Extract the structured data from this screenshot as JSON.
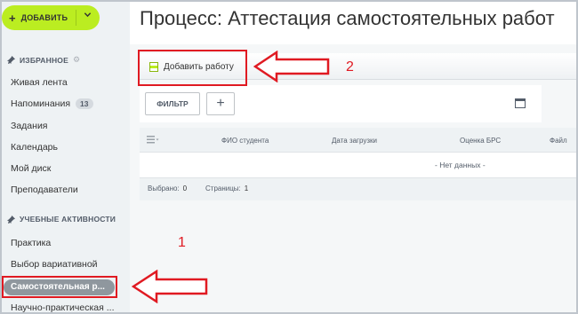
{
  "sidebar": {
    "add_button": {
      "label": "ДОБАВИТЬ",
      "plus": "+",
      "chevron": "⌄"
    },
    "favorites": {
      "title": "ИЗБРАННОЕ",
      "items": [
        {
          "label": "Живая лента"
        },
        {
          "label": "Напоминания",
          "counter": "13"
        },
        {
          "label": "Задания"
        },
        {
          "label": "Календарь"
        },
        {
          "label": "Мой диск"
        },
        {
          "label": "Преподаватели"
        }
      ]
    },
    "activities": {
      "title": "УЧЕБНЫЕ АКТИВНОСТИ",
      "items": [
        {
          "label": "Практика"
        },
        {
          "label": "Выбор вариативной"
        },
        {
          "label": "Самостоятельная р..."
        },
        {
          "label": "Научно-практическая ..."
        }
      ]
    }
  },
  "main": {
    "title": "Процесс: Аттестация самостоятельных работ",
    "toolbar": {
      "add_work_label": "Добавить работу"
    },
    "filter_label": "ФИЛЬТР",
    "add_filter": "+",
    "grid": {
      "columns": [
        "ФИО студента",
        "Дата загрузки",
        "Оценка БРС",
        "Файл"
      ],
      "empty_text": "- Нет данных -",
      "footer": {
        "selected_label": "Выбрано:",
        "selected_value": "0",
        "pages_label": "Страницы:",
        "pages_value": "1"
      }
    }
  },
  "annotations": {
    "marker_1": "1",
    "marker_2": "2",
    "color": "#e01a22"
  },
  "colors": {
    "accent": "#bbed21",
    "active_item": "#8f979e",
    "sidebar_bg": "#eef2f4"
  }
}
